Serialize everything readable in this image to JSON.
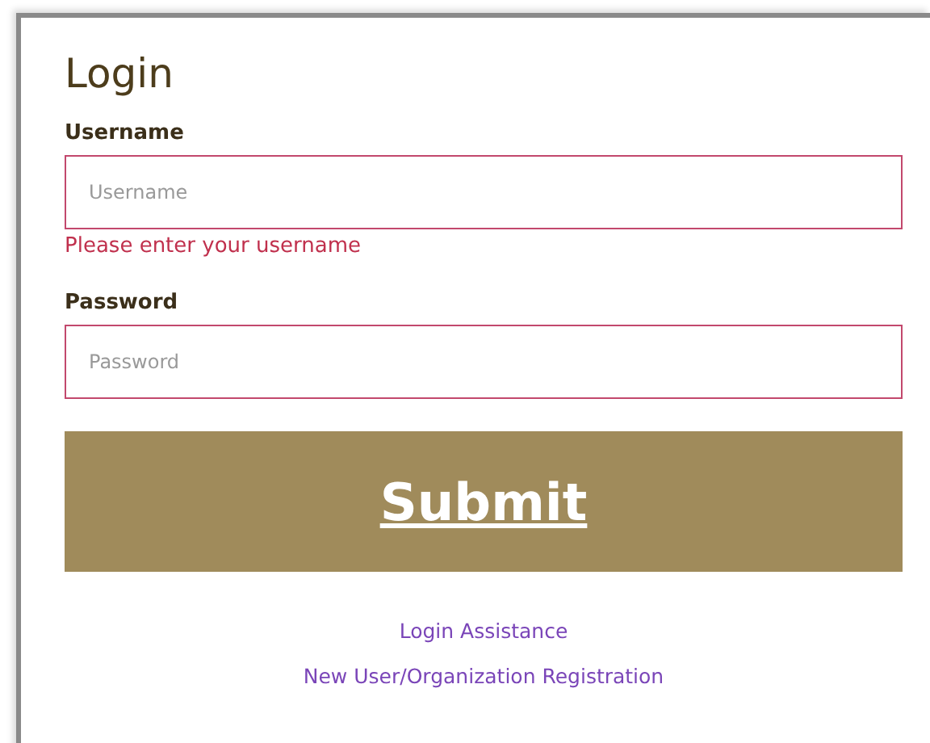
{
  "title": "Login",
  "fields": [
    {
      "label": "Username",
      "placeholder": "Username",
      "invalid": true,
      "error": "Please enter your username"
    },
    {
      "label": "Password",
      "placeholder": "Password",
      "invalid": true
    }
  ],
  "submit": "Submit",
  "links": [
    "Login Assistance",
    "New User/Organization Registration"
  ]
}
